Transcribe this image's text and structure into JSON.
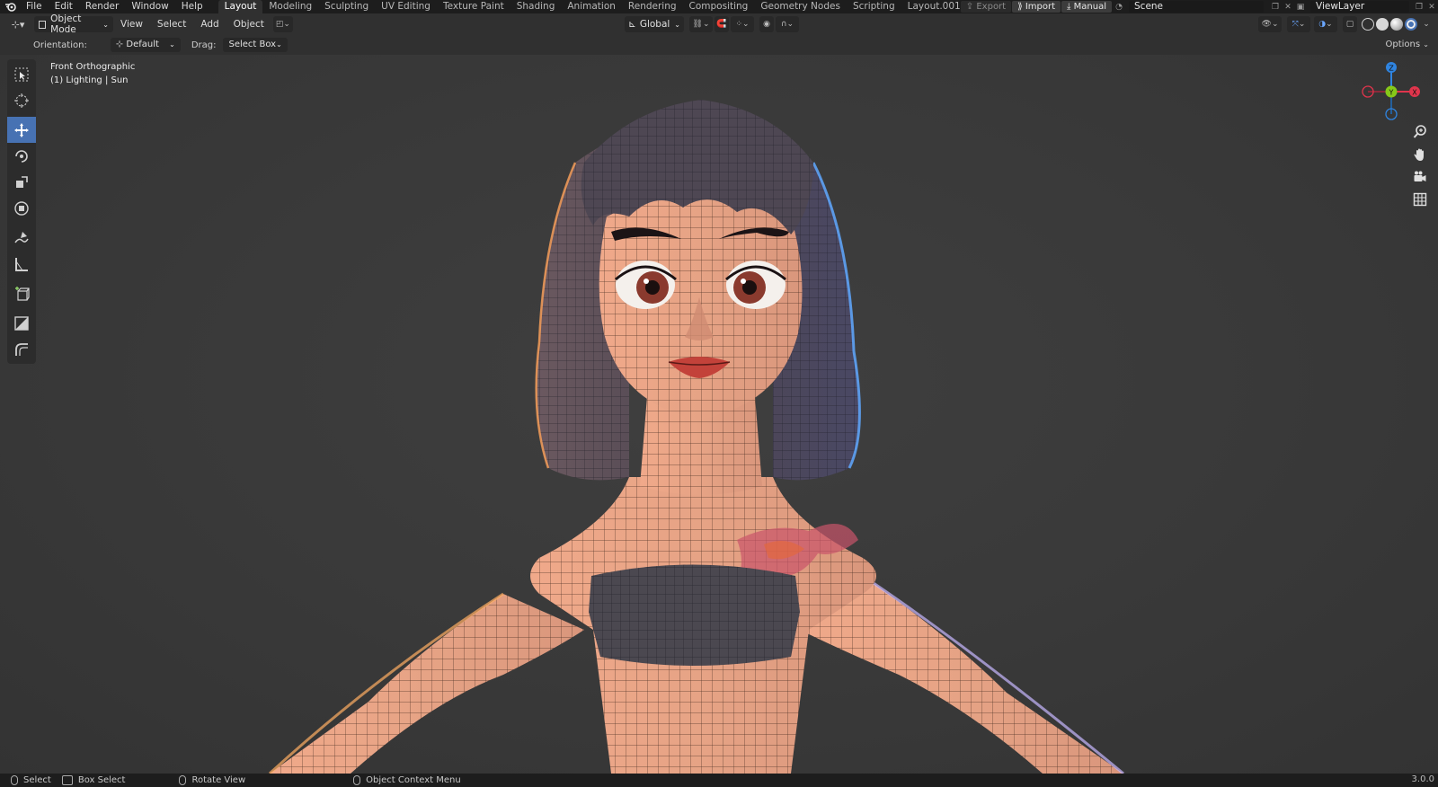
{
  "topbar": {
    "menu": [
      "File",
      "Edit",
      "Render",
      "Window",
      "Help"
    ],
    "workspaces": [
      "Layout",
      "Modeling",
      "Sculpting",
      "UV Editing",
      "Texture Paint",
      "Shading",
      "Animation",
      "Rendering",
      "Compositing",
      "Geometry Nodes",
      "Scripting",
      "Layout.001"
    ],
    "active_workspace": "Layout",
    "export_label": "Export",
    "import_label": "Import",
    "manual_label": "Manual",
    "scene": "Scene",
    "view_layer": "ViewLayer"
  },
  "header": {
    "mode": "Object Mode",
    "menus": [
      "View",
      "Select",
      "Add",
      "Object"
    ],
    "transform_orientation": "Global"
  },
  "tool_settings": {
    "orientation_label": "Orientation:",
    "orientation_value": "Default",
    "drag_label": "Drag:",
    "drag_value": "Select Box",
    "options_label": "Options"
  },
  "viewport": {
    "view_name": "Front Orthographic",
    "collection_info": "(1) Lighting | Sun"
  },
  "gizmo": {
    "x_label": "X",
    "y_label": "Y",
    "z_label": "Z",
    "x_color": "#e0354c",
    "y_color": "#86c919",
    "z_color": "#2f84e0"
  },
  "statusbar": {
    "select": "Select",
    "box_select": "Box Select",
    "rotate_view": "Rotate View",
    "context_menu": "Object Context Menu",
    "version": "3.0.0"
  },
  "colors": {
    "active_tool": "#4772b3",
    "header_bg": "#303030",
    "viewport_bg": "#393939"
  }
}
